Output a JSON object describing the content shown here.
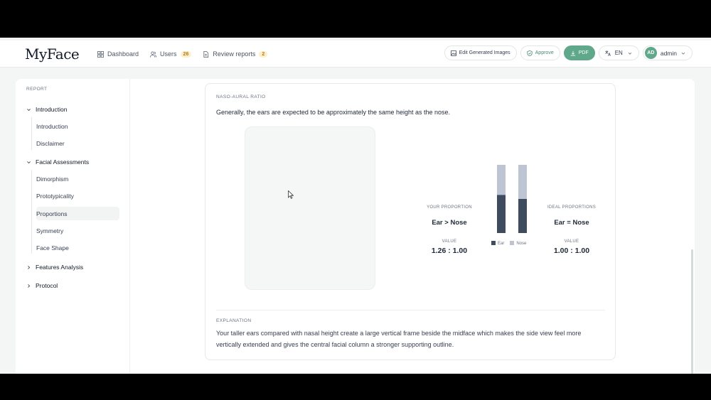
{
  "header": {
    "logo": "MyFace",
    "nav": [
      {
        "label": "Dashboard",
        "icon": "dashboard-icon"
      },
      {
        "label": "Users",
        "icon": "users-icon",
        "badge": "26"
      },
      {
        "label": "Review reports",
        "icon": "document-icon",
        "badge": "2"
      }
    ],
    "edit_images_label": "Edit Generated Images",
    "approve_label": "Approve",
    "pdf_label": "PDF",
    "lang_label": "EN",
    "avatar_initials": "AD",
    "user_label": "admin"
  },
  "sidebar": {
    "title": "REPORT",
    "groups": [
      {
        "label": "Introduction",
        "expanded": true,
        "items": [
          "Introduction",
          "Disclaimer"
        ]
      },
      {
        "label": "Facial Assessments",
        "expanded": true,
        "items": [
          "Dimorphism",
          "Prototypicality",
          "Proportions",
          "Symmetry",
          "Face Shape"
        ]
      },
      {
        "label": "Features Analysis",
        "expanded": false,
        "items": []
      },
      {
        "label": "Protocol",
        "expanded": false,
        "items": []
      }
    ],
    "active_item": "Proportions"
  },
  "section": {
    "label": "NASO-AURAL RATIO",
    "description": "Generally, the ears are expected to be approximately the same height as the nose.",
    "your": {
      "caption": "YOUR PROPORTION",
      "main": "Ear > Nose",
      "value_caption": "VALUE",
      "value": "1.26 : 1.00"
    },
    "ideal": {
      "caption": "IDEAL PROPORTIONS",
      "main": "Ear = Nose",
      "value_caption": "VALUE",
      "value": "1.00 : 1.00"
    },
    "explanation_label": "EXPLANATION",
    "explanation": "Your taller ears compared with nasal height create a large vertical frame beside the midface which makes the side view feel more vertically extended and gives the central facial column a stronger supporting outline."
  },
  "chart_data": {
    "type": "bar",
    "stacked": true,
    "categories": [
      "",
      ""
    ],
    "series": [
      {
        "name": "Ear",
        "values": [
          0.56,
          0.5
        ],
        "color": "#3f4b5e"
      },
      {
        "name": "Nose",
        "values": [
          0.44,
          0.5
        ],
        "color": "#bcc5d1"
      }
    ],
    "ylim": [
      0,
      1
    ],
    "legend": "bottom"
  },
  "colors": {
    "accent": "#5fa88a",
    "badge_bg": "#fdf0c9",
    "badge_text": "#b7791f",
    "ear": "#3f4b5e",
    "nose": "#bcc5d1"
  }
}
